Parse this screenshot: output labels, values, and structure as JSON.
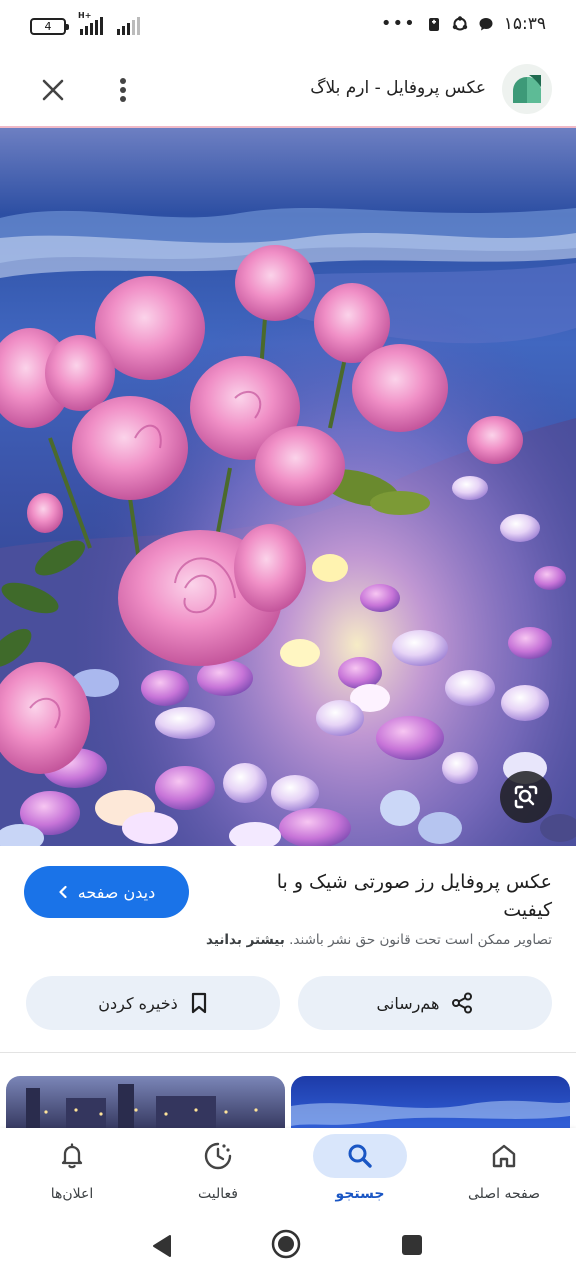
{
  "status_bar": {
    "battery_level": "4",
    "network_type": "H+",
    "overflow_dots": "•••",
    "time": "۱۵:۳۹"
  },
  "header": {
    "site_title": "عکس پروفایل - ارم بلاگ"
  },
  "image_info": {
    "title": "عکس پروفایل رز صورتی شیک و با کیفیت",
    "visit_button": "دیدن صفحه",
    "copyright_text": "تصاویر ممکن است تحت قانون حق نشر باشند.",
    "learn_more": "بیشتر بدانید"
  },
  "actions": {
    "share_label": "هم‌رسانی",
    "save_label": "ذخیره کردن"
  },
  "bottom_nav": {
    "items": [
      {
        "label": "صفحه اصلی",
        "icon": "home-icon",
        "active": false
      },
      {
        "label": "جستجو",
        "icon": "search-icon",
        "active": true
      },
      {
        "label": "فعالیت",
        "icon": "activity-icon",
        "active": false
      },
      {
        "label": "اعلان‌ها",
        "icon": "bell-icon",
        "active": false
      }
    ]
  },
  "colors": {
    "accent": "#1a73e8",
    "active_pill": "#d9e6fb",
    "action_button_bg": "#eaf0f8"
  }
}
